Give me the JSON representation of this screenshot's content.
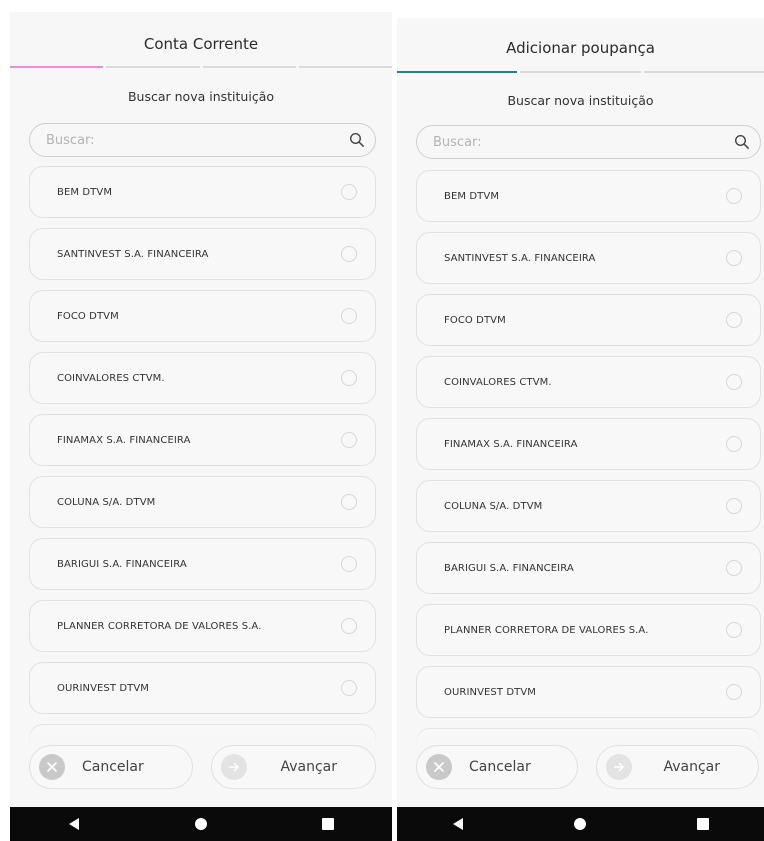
{
  "colors": {
    "left_accent": "#e98ee0",
    "right_accent": "#2a7f83",
    "step_inactive": "#dadada",
    "screen_bg": "#f7f7f7"
  },
  "screens": [
    {
      "title": "Conta Corrente",
      "steps": {
        "total": 4,
        "active": 1
      },
      "subtitle": "Buscar nova instituição",
      "search": {
        "placeholder": "Buscar:",
        "value": "",
        "icon": "search-icon"
      },
      "institutions": [
        "BEM  DTVM",
        "SANTINVEST S.A.  FINANCEIRA",
        "FOCO DTVM",
        "COINVALORES CTVM.",
        "FINAMAX S.A.  FINANCEIRA",
        "COLUNA S/A. DTVM",
        "BARIGUI S.A. FINANCEIRA",
        "PLANNER CORRETORA DE VALORES S.A.",
        "OURINVEST DTVM"
      ],
      "buttons": {
        "cancel": "Cancelar",
        "next": "Avançar"
      }
    },
    {
      "title": "Adicionar poupança",
      "steps": {
        "total": 3,
        "active": 1
      },
      "subtitle": "Buscar nova instituição",
      "search": {
        "placeholder": "Buscar:",
        "value": "",
        "icon": "search-icon"
      },
      "institutions": [
        "BEM  DTVM",
        "SANTINVEST S.A.  FINANCEIRA",
        "FOCO DTVM",
        "COINVALORES CTVM.",
        "FINAMAX S.A.  FINANCEIRA",
        "COLUNA S/A. DTVM",
        "BARIGUI S.A. FINANCEIRA",
        "PLANNER CORRETORA DE VALORES S.A.",
        "OURINVEST DTVM"
      ],
      "buttons": {
        "cancel": "Cancelar",
        "next": "Avançar"
      }
    }
  ],
  "navigation_bar": {
    "icons": [
      "back-icon",
      "home-icon",
      "recent-apps-icon"
    ]
  }
}
